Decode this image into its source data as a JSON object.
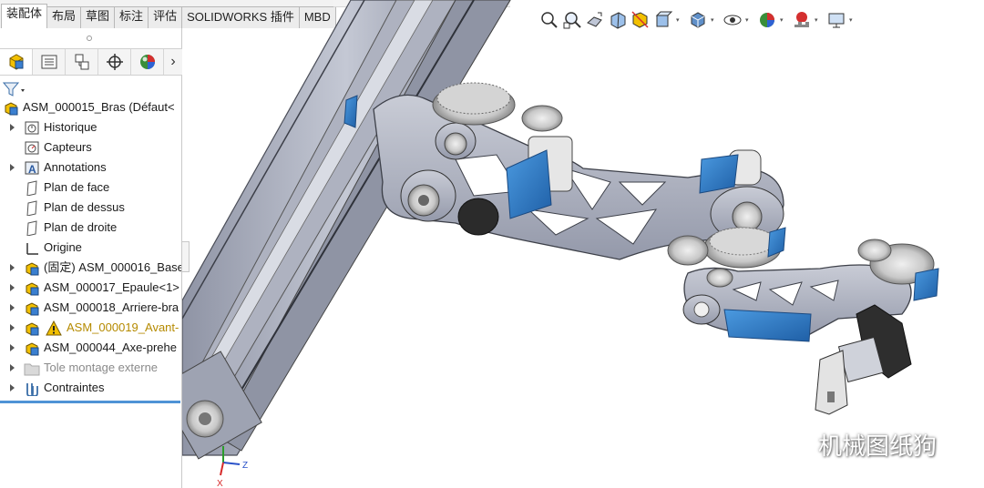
{
  "tabs": [
    {
      "label": "装配体",
      "active": true
    },
    {
      "label": "布局"
    },
    {
      "label": "草图"
    },
    {
      "label": "标注"
    },
    {
      "label": "评估"
    },
    {
      "label": "SOLIDWORKS 插件"
    },
    {
      "label": "MBD"
    }
  ],
  "manager_tabs": [
    "featuremanager-tab",
    "propertymanager-tab",
    "configurationmanager-tab",
    "dimxpert-tab",
    "displaymanager-tab"
  ],
  "tree": [
    {
      "label": "ASM_000015_Bras  (Défaut<",
      "icon": "assembly-icon",
      "expand": false,
      "indent": 0
    },
    {
      "label": "Historique",
      "icon": "history-icon",
      "expand": true,
      "indent": 1
    },
    {
      "label": "Capteurs",
      "icon": "sensors-icon",
      "expand": false,
      "indent": 1
    },
    {
      "label": "Annotations",
      "icon": "annotations-icon",
      "expand": true,
      "indent": 1
    },
    {
      "label": "Plan de face",
      "icon": "plane-icon",
      "expand": false,
      "indent": 1
    },
    {
      "label": "Plan de dessus",
      "icon": "plane-icon",
      "expand": false,
      "indent": 1
    },
    {
      "label": "Plan de droite",
      "icon": "plane-icon",
      "expand": false,
      "indent": 1
    },
    {
      "label": "Origine",
      "icon": "origin-icon",
      "expand": false,
      "indent": 1
    },
    {
      "label": "(固定) ASM_000016_Base",
      "icon": "subassembly-icon",
      "expand": true,
      "indent": 1
    },
    {
      "label": "ASM_000017_Epaule<1>",
      "icon": "subassembly-icon",
      "expand": true,
      "indent": 1
    },
    {
      "label": "ASM_000018_Arriere-bra",
      "icon": "subassembly-icon",
      "expand": true,
      "indent": 1
    },
    {
      "label": "ASM_000019_Avant-",
      "icon": "subassembly-icon",
      "expand": true,
      "indent": 1,
      "warning": true
    },
    {
      "label": "ASM_000044_Axe-prehe",
      "icon": "subassembly-icon",
      "expand": true,
      "indent": 1
    },
    {
      "label": "Tole montage externe",
      "icon": "folder-icon",
      "expand": true,
      "indent": 1,
      "grey": true
    },
    {
      "label": "Contraintes",
      "icon": "mates-icon",
      "expand": true,
      "indent": 1
    }
  ],
  "hud_tools": [
    "zoom-to-fit-icon",
    "zoom-to-area-icon",
    "previous-view-icon",
    "section-view-icon",
    "dynamic-annotation-icon",
    "view-orientation-icon",
    "display-style-icon",
    "hide-show-items-icon",
    "edit-appearance-icon",
    "apply-scene-icon",
    "view-settings-icon"
  ],
  "triad": {
    "z": "Z",
    "x": "X"
  },
  "watermark": "机械图纸狗",
  "colors": {
    "accent": "#4f93d6",
    "warning": "#e6b800",
    "part_grey": "#a9aebe",
    "motor_blue": "#2f7ecb"
  }
}
